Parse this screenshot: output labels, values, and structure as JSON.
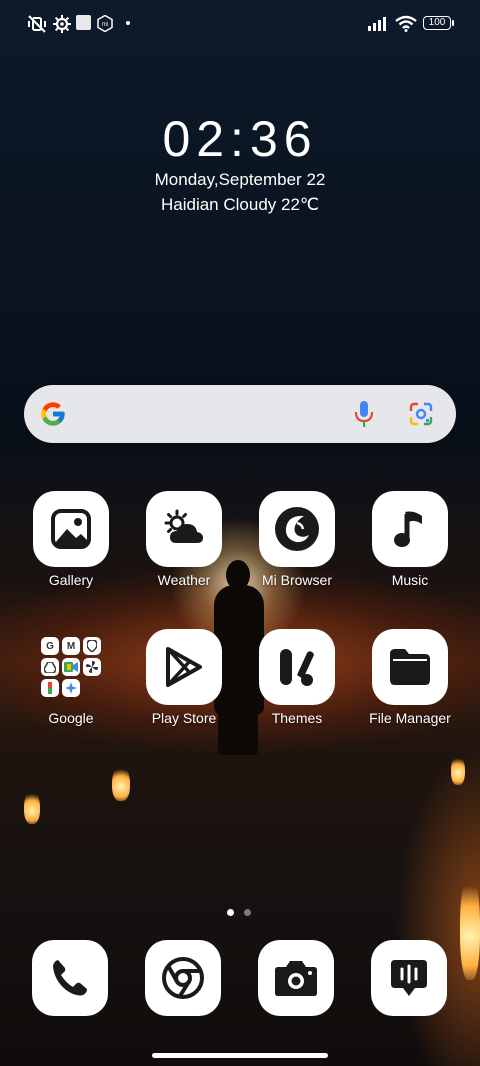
{
  "status_bar": {
    "battery": "100",
    "left_icons": [
      "vibrate-off-icon",
      "settings-gear-icon",
      "square-notification-icon",
      "mi-icon",
      "dot-icon"
    ],
    "right_icons": [
      "signal-icon",
      "wifi-icon",
      "battery-icon"
    ]
  },
  "clock_widget": {
    "time": "02:36",
    "date": "Monday,September 22",
    "weather": "Haidian Cloudy 22℃"
  },
  "search": {
    "icons": [
      "google-logo-icon",
      "microphone-icon",
      "google-lens-icon"
    ]
  },
  "apps": [
    {
      "label": "Gallery",
      "icon": "gallery-icon"
    },
    {
      "label": "Weather",
      "icon": "weather-icon"
    },
    {
      "label": "Mi Browser",
      "icon": "browser-icon"
    },
    {
      "label": "Music",
      "icon": "music-note-icon"
    },
    {
      "label": "Google",
      "icon": "folder-icon"
    },
    {
      "label": "Play Store",
      "icon": "play-store-icon"
    },
    {
      "label": "Themes",
      "icon": "themes-icon"
    },
    {
      "label": "File Manager",
      "icon": "folder-icon"
    }
  ],
  "google_folder_apps": [
    "G",
    "M",
    "maps",
    "drive",
    "meet",
    "pinwheel",
    "pay",
    "star"
  ],
  "page_indicator": {
    "pages": 2,
    "current": 1
  },
  "dock": [
    {
      "icon": "phone-icon"
    },
    {
      "icon": "chrome-icon"
    },
    {
      "icon": "camera-icon"
    },
    {
      "icon": "messaging-icon"
    }
  ],
  "colors": {
    "icon_fg": "#1a1a1a",
    "icon_bg": "#ffffff",
    "search_bg": "#eef0f2"
  }
}
